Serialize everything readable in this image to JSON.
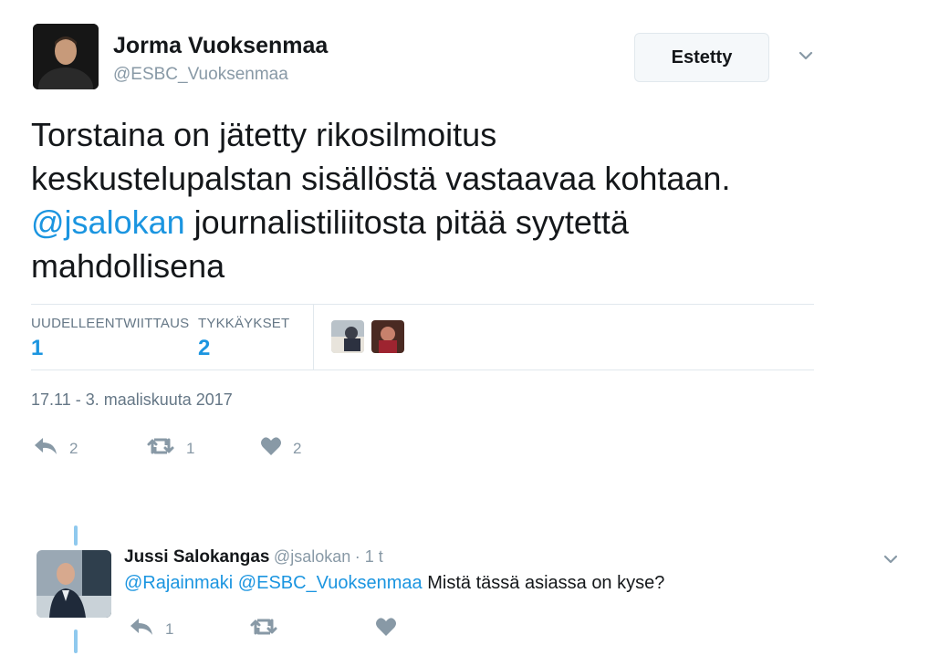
{
  "tweet": {
    "author_name": "Jorma Vuoksenmaa",
    "author_handle": "@ESBC_Vuoksenmaa",
    "blocked_button": "Estetty",
    "text_line1": "Torstaina on jätetty rikosilmoitus",
    "text_line2": "keskustelupalstan sisällöstä vastaavaa kohtaan.",
    "text_mention": "@jsalokan",
    "text_line3_rest": " journalistiliitosta pitää syytettä",
    "text_line4": "mahdollisena",
    "stats": {
      "retweets_label": "UUDELLEENTWIITTAUS",
      "retweets_value": "1",
      "likes_label": "TYKKÄYKSET",
      "likes_value": "2"
    },
    "timestamp": "17.11 - 3. maaliskuuta 2017",
    "actions": {
      "reply_count": "2",
      "retweet_count": "1",
      "like_count": "2"
    }
  },
  "reply": {
    "author_name": "Jussi Salokangas",
    "author_handle": "@jsalokan",
    "time": "· 1 t",
    "mention1": "@Rajainmaki",
    "mention2": "@ESBC_Vuoksenmaa",
    "text": " Mistä tässä asiassa on kyse?",
    "actions": {
      "reply_count": "1",
      "retweet_count": "",
      "like_count": ""
    }
  },
  "icons": {
    "dropdown": "chevron-down-icon",
    "reply": "reply-icon",
    "retweet": "retweet-icon",
    "like": "heart-icon"
  },
  "colors": {
    "link": "#1b95e0",
    "muted": "#8899a6",
    "thread": "#8fc9ee"
  }
}
